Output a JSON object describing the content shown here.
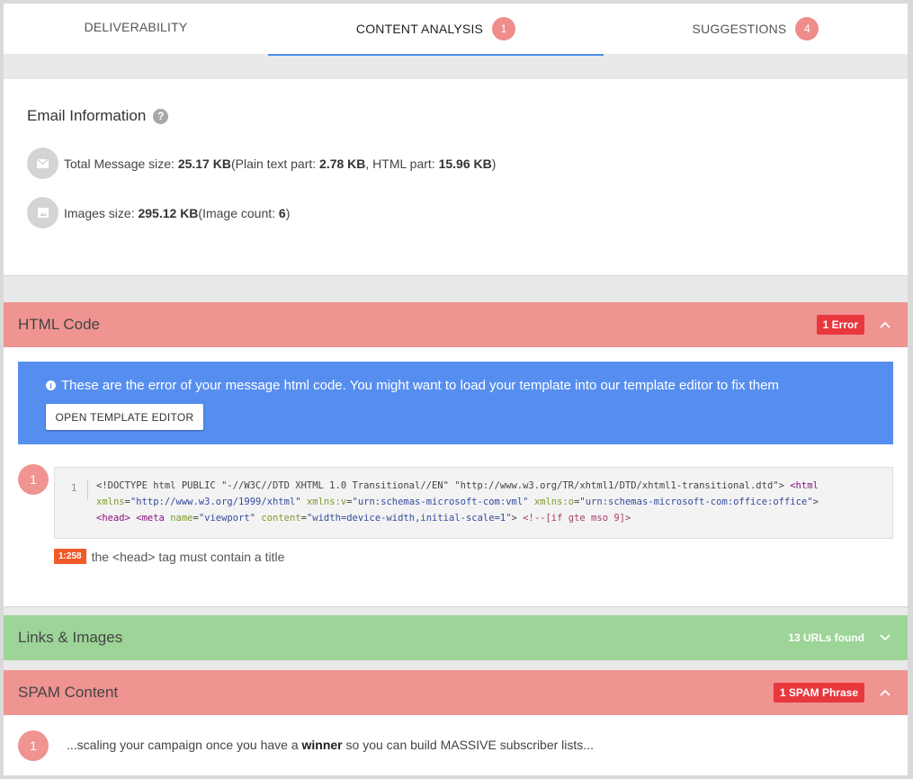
{
  "tabs": [
    {
      "label": "DELIVERABILITY",
      "count": ""
    },
    {
      "label": "CONTENT ANALYSIS",
      "count": "1"
    },
    {
      "label": "SUGGESTIONS",
      "count": "4"
    }
  ],
  "email_info": {
    "title": "Email Information",
    "help": "?",
    "total_label": "Total Message size: ",
    "total_value": "25.17 KB",
    "plain_label": " (Plain text part: ",
    "plain_value": "2.78 KB",
    "html_label": ", HTML part: ",
    "html_value": "15.96 KB",
    "close_paren": ")",
    "images_label": "Images size: ",
    "images_value": "295.12 KB",
    "count_label": " (Image count: ",
    "count_value": "6",
    "close_paren2": ")"
  },
  "html_code": {
    "title": "HTML Code",
    "badge": "1 Error",
    "alert_text": "These are the error of your message html code. You might want to load your template into our template editor to fix them",
    "button_label": "OPEN TEMPLATE EDITOR",
    "error_number": "1",
    "line_number": "1",
    "error_position": "1:258",
    "error_message": "the <head> tag must contain a title"
  },
  "links": {
    "title": "Links & Images",
    "badge": "13 URLs found"
  },
  "spam": {
    "title": "SPAM Content",
    "badge": "1 SPAM Phrase",
    "number": "1",
    "text_before": "...scaling your campaign once you have a ",
    "highlight": "winner",
    "text_after": " so you can build MASSIVE subscriber lists..."
  },
  "colors": {
    "accent": "#4a8ee8",
    "error_header": "#ef9491",
    "success_header": "#9dd598",
    "badge_red": "#e8383d",
    "alert_blue": "#568ef0",
    "error_pos": "#f25a29"
  }
}
